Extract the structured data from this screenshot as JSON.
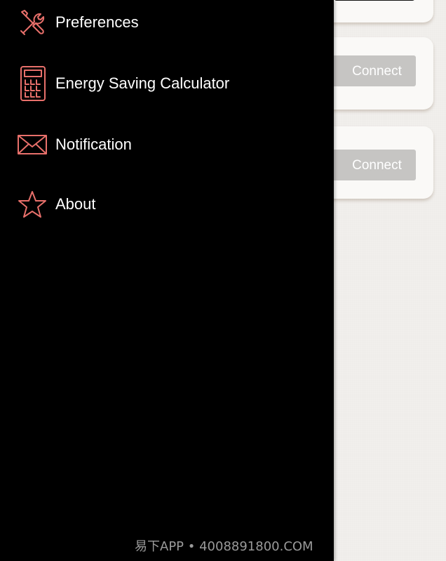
{
  "background": {
    "cards": [
      {
        "button_label": "Connect"
      },
      {
        "button_label": "Connect"
      }
    ]
  },
  "drawer": {
    "items": [
      {
        "label": "Preferences",
        "icon": "wrench-screwdriver-icon"
      },
      {
        "label": "Energy Saving Calculator",
        "icon": "calculator-icon"
      },
      {
        "label": "Notification",
        "icon": "envelope-icon"
      },
      {
        "label": "About",
        "icon": "star-icon"
      }
    ]
  },
  "watermark": "易下APP • 4008891800.COM",
  "colors": {
    "drawer_bg": "#000000",
    "icon_accent": "#e8706b",
    "button_bg": "#c6c5c3",
    "page_bg": "#f1efec"
  }
}
